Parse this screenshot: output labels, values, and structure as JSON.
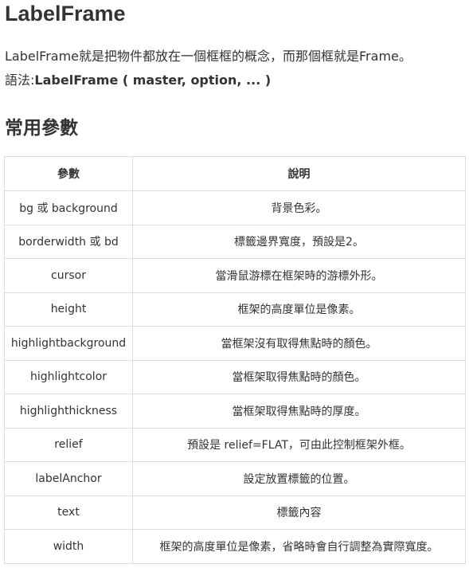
{
  "title": "LabelFrame",
  "intro": {
    "line1": "LabelFrame就是把物件都放在一個框框的概念，而那個框就是Frame。",
    "syntax_label": "語法:",
    "syntax_value": "LabelFrame ( master, option, ... )"
  },
  "section_heading": "常用參數",
  "table": {
    "headers": [
      "參數",
      "說明"
    ],
    "rows": [
      [
        "bg 或 background",
        "背景色彩。"
      ],
      [
        "borderwidth 或 bd",
        "標籤邊界寬度，預設是2。"
      ],
      [
        "cursor",
        "當滑鼠游標在框架時的游標外形。"
      ],
      [
        "height",
        "框架的高度單位是像素。"
      ],
      [
        "highlightbackground",
        "當框架沒有取得焦點時的顏色。"
      ],
      [
        "highlightcolor",
        "當框架取得焦點時的顏色。"
      ],
      [
        "highlighthickness",
        "當框架取得焦點時的厚度。"
      ],
      [
        "relief",
        "預設是 relief=FLAT，可由此控制框架外框。"
      ],
      [
        "labelAnchor",
        "設定放置標籤的位置。"
      ],
      [
        "text",
        "標籤內容"
      ],
      [
        "width",
        "框架的高度單位是像素，省略時會自行調整為實際寬度。"
      ]
    ]
  },
  "colors": {
    "text": "#333333",
    "border": "#dddddd",
    "background": "#ffffff"
  }
}
